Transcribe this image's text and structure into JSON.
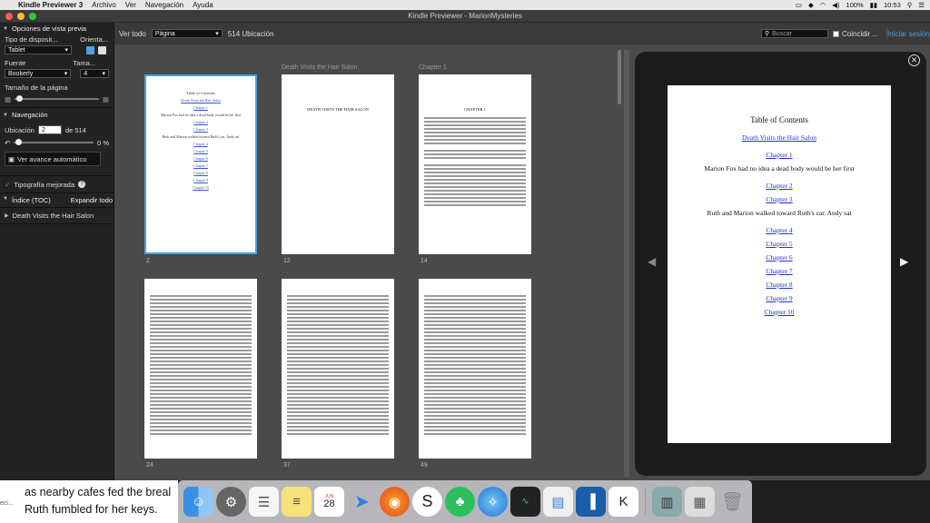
{
  "menubar": {
    "app_name": "Kindle Previewer 3",
    "items": [
      "Archivo",
      "Ver",
      "Navegación",
      "Ayuda"
    ],
    "battery": "100%",
    "clock": "10:53"
  },
  "window": {
    "title": "Kindle Previewer - MarionMysteries"
  },
  "sidebar": {
    "preview_options": "Opciones de vista previa",
    "device_type_label": "Tipo de disposit...",
    "orientation_label": "Orienta...",
    "device_value": "Tablet",
    "font_label": "Fuente",
    "size_label": "Tama...",
    "font_value": "Bookerly",
    "size_value": "4",
    "page_size_label": "Tamaño de la página",
    "navigation": "Navegación",
    "location_label": "Ubicación",
    "location_value": "2",
    "location_of": "de 514",
    "percent": "0 %",
    "autoplay": "Ver avance automático",
    "enhanced_typo": "Tipografía mejorada",
    "toc_label": "Índice (TOC)",
    "expand_all": "Expandir todo",
    "toc_item": "Death Visits the Hair Salon"
  },
  "toolbar": {
    "view_all": "Ver todo",
    "view_mode": "Página",
    "locations": "514 Ubicación",
    "search_placeholder": "Buscar",
    "match_label": "Coincidir ...",
    "signin": "Iniciar sesión"
  },
  "grid": {
    "chapter_label_1": "Death Visits the Hair Salon",
    "chapter_label_2": "Chapter 1",
    "page_numbers": [
      "2",
      "12",
      "14",
      "24",
      "37",
      "49"
    ],
    "title_page_text": "DEATH VISITS THE HAIR SALON",
    "chapter_heading": "CHAPTER 1"
  },
  "preview": {
    "toc_title": "Table of Contents",
    "entries": [
      {
        "text": "Death Visits the Hair Salon",
        "link": true
      },
      {
        "text": "Chapter 1",
        "link": true
      },
      {
        "text": "Marion Fox had no idea a dead body would be her first",
        "link": false
      },
      {
        "text": "Chapter 2",
        "link": true
      },
      {
        "text": "Chapter 3",
        "link": true
      },
      {
        "text": "Ruth and Marion walked toward Ruth's car. Andy sat",
        "link": false
      },
      {
        "text": "Chapter 4",
        "link": true
      },
      {
        "text": "Chapter 5",
        "link": true
      },
      {
        "text": "Chapter 6",
        "link": true
      },
      {
        "text": "Chapter 7",
        "link": true
      },
      {
        "text": "Chapter 8",
        "link": true
      },
      {
        "text": "Chapter 9",
        "link": true
      },
      {
        "text": "Chapter 10",
        "link": true
      }
    ]
  },
  "background_text": {
    "line1": "as nearby cafes fed the breal",
    "line2": "Ruth fumbled for her keys.",
    "left_fragment": "eci..."
  },
  "dock": {
    "calendar_month": "JUN",
    "calendar_day": "28"
  }
}
